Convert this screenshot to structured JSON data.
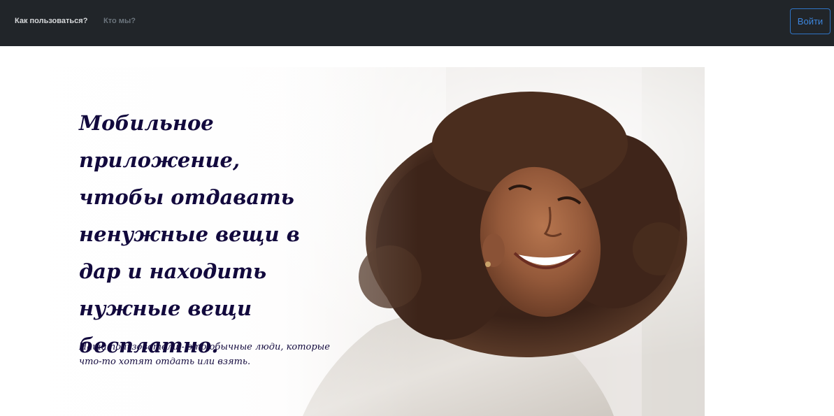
{
  "navbar": {
    "how_to_use": "Как пользоваться?",
    "who_we_are": "Кто мы?",
    "login_label": "Войти",
    "background": "#212529"
  },
  "hero": {
    "title": "Мобильное приложение, чтобы отдавать ненужные вещи в дар и находить нужные вещи бесплатно.",
    "subtitle": "Наши пользователи - это обычные люди, которые что-то хотят отдать или взять.",
    "text_color": "#12093d",
    "image": "smiling-woman-photo"
  }
}
